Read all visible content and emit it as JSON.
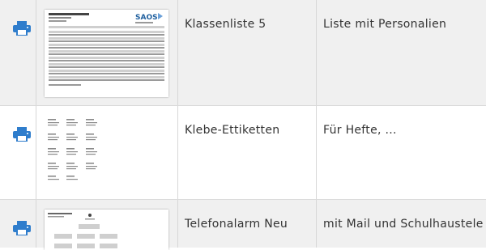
{
  "rows": [
    {
      "name": "Klassenliste 5",
      "description": "Liste mit Personalien",
      "icon": "printer-icon",
      "thumbnail": {
        "brand": "SAOS"
      }
    },
    {
      "name": "Klebe-Ettiketten",
      "description": "Für Hefte, ...",
      "icon": "printer-icon"
    },
    {
      "name": "Telefonalarm Neu",
      "description": "mit Mail und Schulhaustele",
      "icon": "printer-icon"
    }
  ],
  "colors": {
    "accent": "#2f7dcc",
    "row_alt_bg": "#f0f0f0",
    "text": "#333333"
  }
}
